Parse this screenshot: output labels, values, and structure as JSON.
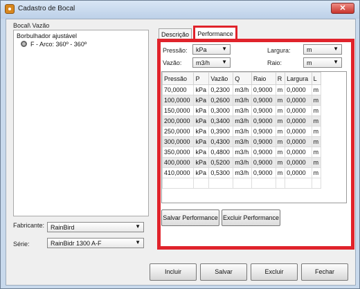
{
  "window": {
    "title": "Cadastro de Bocal",
    "close_glyph": "✕"
  },
  "left": {
    "group_label": "Bocal\\ Vazão",
    "list_items": [
      "Borbulhador ajustável",
      "F - Arco: 360º - 360º"
    ],
    "fabricante_label": "Fabricante:",
    "fabricante_value": "RainBird",
    "serie_label": "Série:",
    "serie_value": "RainBidr 1300 A-F"
  },
  "tabs": [
    {
      "label": "Descrição",
      "active": false
    },
    {
      "label": "Performance",
      "active": true
    }
  ],
  "fields": {
    "pressao_label": "Pressão:",
    "pressao_value": "kPa",
    "vazao_label": "Vazão:",
    "vazao_value": "m3/h",
    "largura_label": "Largura:",
    "largura_value": "m",
    "raio_label": "Raio:",
    "raio_value": "m"
  },
  "table": {
    "headers": [
      "Pressão",
      "P",
      "Vazão",
      "Q",
      "Raio",
      "R",
      "Largura",
      "L"
    ],
    "rows": [
      [
        "70,0000",
        "kPa",
        "0,2300",
        "m3/h",
        "0,9000",
        "m",
        "0,0000",
        "m"
      ],
      [
        "100,0000",
        "kPa",
        "0,2600",
        "m3/h",
        "0,9000",
        "m",
        "0,0000",
        "m"
      ],
      [
        "150,0000",
        "kPa",
        "0,3000",
        "m3/h",
        "0,9000",
        "m",
        "0,0000",
        "m"
      ],
      [
        "200,0000",
        "kPa",
        "0,3400",
        "m3/h",
        "0,9000",
        "m",
        "0,0000",
        "m"
      ],
      [
        "250,0000",
        "kPa",
        "0,3900",
        "m3/h",
        "0,9000",
        "m",
        "0,0000",
        "m"
      ],
      [
        "300,0000",
        "kPa",
        "0,4300",
        "m3/h",
        "0,9000",
        "m",
        "0,0000",
        "m"
      ],
      [
        "350,0000",
        "kPa",
        "0,4800",
        "m3/h",
        "0,9000",
        "m",
        "0,0000",
        "m"
      ],
      [
        "400,0000",
        "kPa",
        "0,5200",
        "m3/h",
        "0,9000",
        "m",
        "0,0000",
        "m"
      ],
      [
        "410,0000",
        "kPa",
        "0,5300",
        "m3/h",
        "0,9000",
        "m",
        "0,0000",
        "m"
      ]
    ]
  },
  "performance_buttons": {
    "save": "Salvar Performance",
    "delete": "Excluir Performance"
  },
  "footer_buttons": {
    "include": "Incluir",
    "save": "Salvar",
    "delete": "Excluir",
    "close": "Fechar"
  },
  "colors": {
    "highlight": "#e0232b"
  }
}
